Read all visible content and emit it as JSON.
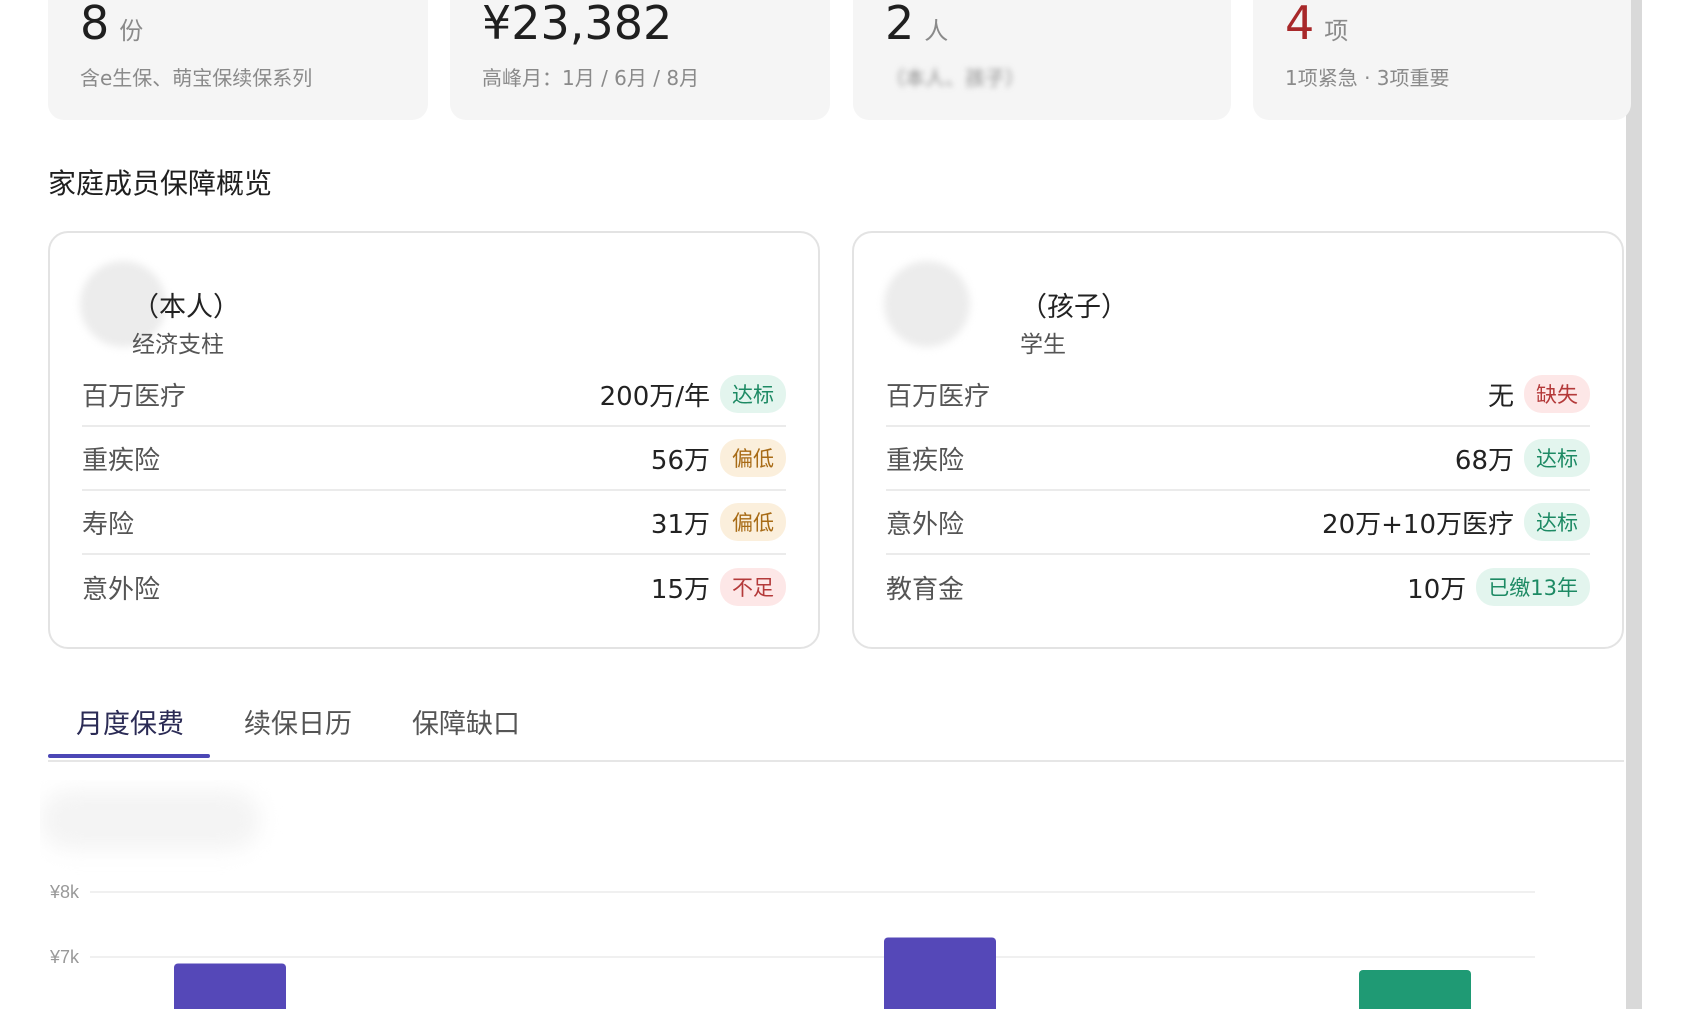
{
  "stats": [
    {
      "value": "8",
      "unit": "份",
      "sub": "含e生保、萌宝保续保系列",
      "value_color": "#1f1f1f"
    },
    {
      "value": "¥23,382",
      "unit": "",
      "sub": "高峰月：1月 / 6月 / 8月",
      "value_color": "#1f1f1f"
    },
    {
      "value": "2",
      "unit": "人",
      "sub": "（本人、孩子）",
      "value_color": "#1f1f1f"
    },
    {
      "value": "4",
      "unit": "项",
      "sub": "1项紧急 · 3项重要",
      "value_color": "#a8282a"
    }
  ],
  "section_title": "家庭成员保障概览",
  "members": [
    {
      "name": "（本人）",
      "role": "经济支柱",
      "coverages": [
        {
          "name": "百万医疗",
          "value": "200万/年",
          "badge": "达标",
          "level": "ok"
        },
        {
          "name": "重疾险",
          "value": "56万",
          "badge": "偏低",
          "level": "low"
        },
        {
          "name": "寿险",
          "value": "31万",
          "badge": "偏低",
          "level": "low"
        },
        {
          "name": "意外险",
          "value": "15万",
          "badge": "不足",
          "level": "bad"
        }
      ]
    },
    {
      "name": "（孩子）",
      "role": "学生",
      "coverages": [
        {
          "name": "百万医疗",
          "value": "无",
          "badge": "缺失",
          "level": "bad"
        },
        {
          "name": "重疾险",
          "value": "68万",
          "badge": "达标",
          "level": "ok"
        },
        {
          "name": "意外险",
          "value": "20万+10万医疗",
          "badge": "达标",
          "level": "ok"
        },
        {
          "name": "教育金",
          "value": "10万",
          "badge": "已缴13年",
          "level": "ok"
        }
      ]
    }
  ],
  "tabs": [
    {
      "label": "月度保费",
      "active": true
    },
    {
      "label": "续保日历",
      "active": false
    },
    {
      "label": "保障缺口",
      "active": false
    }
  ],
  "chart_data": {
    "type": "bar",
    "y_tick_labels": [
      "¥8k",
      "¥7k"
    ],
    "y_ticks": [
      8000,
      7000
    ],
    "visible_y_range": [
      6300,
      8300
    ],
    "bars": [
      {
        "value": 6900,
        "color": "#5548b8"
      },
      {
        "value": 7300,
        "color": "#5548b8"
      },
      {
        "value": 6800,
        "color": "#1f9a74"
      }
    ]
  }
}
